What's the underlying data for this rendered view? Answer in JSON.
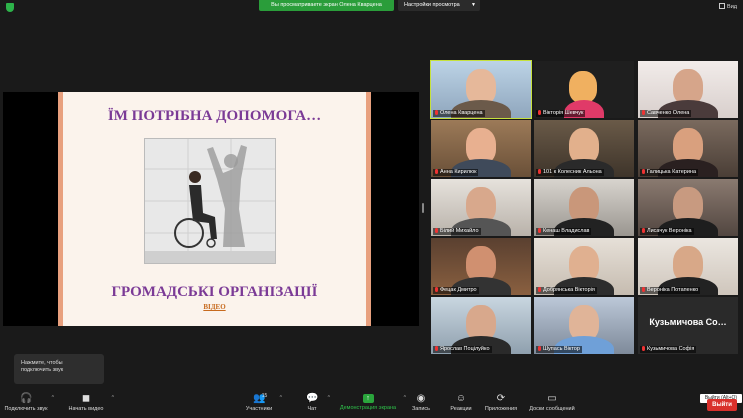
{
  "topbar": {
    "share_banner": "Вы просматриваете экран Олена Кварцена",
    "view_options": "Настройки просмотра",
    "view_button": "Вид"
  },
  "slide": {
    "title": "ЇМ ПОТРІБНА ДОПОМОГА…",
    "subtitle": "ГРОМАДСЬКІ ОРГАНІЗАЦІЇ",
    "link": "ВІДЕО"
  },
  "participants": [
    {
      "name": "Олена Кварцена",
      "active": true
    },
    {
      "name": "Вікторія Шевчук"
    },
    {
      "name": "Савченко Олена"
    },
    {
      "name": "Анна Кирилюк"
    },
    {
      "name": "101 к Колесник Альона"
    },
    {
      "name": "Галицька Катерина"
    },
    {
      "name": "Білий Михайло"
    },
    {
      "name": "Кенаш Владислав"
    },
    {
      "name": "Лисачук Вероніка"
    },
    {
      "name": "Фецак Дмитро"
    },
    {
      "name": "Добрянська Вікторія"
    },
    {
      "name": "Вероніка Потапенко"
    },
    {
      "name": "Ярослав Поцілуйко"
    },
    {
      "name": "Шупась Віктор"
    },
    {
      "name": "Кузьмичова Софія",
      "display_text": "Кузьмичова Со…"
    }
  ],
  "toast": {
    "line1": "Нажмите, чтобы",
    "line2": "подключить звук"
  },
  "tooltip": "Выйти (Alt+Q)",
  "toolbar": {
    "audio": "Подключить звук",
    "video": "Начать видео",
    "participants": "Участники",
    "participants_count": "15",
    "chat": "Чат",
    "share": "Демонстрация экрана",
    "record": "Запись",
    "reactions": "Реакции",
    "apps": "Приложения",
    "whiteboard": "Доски сообщений",
    "leave": "Выйти"
  }
}
